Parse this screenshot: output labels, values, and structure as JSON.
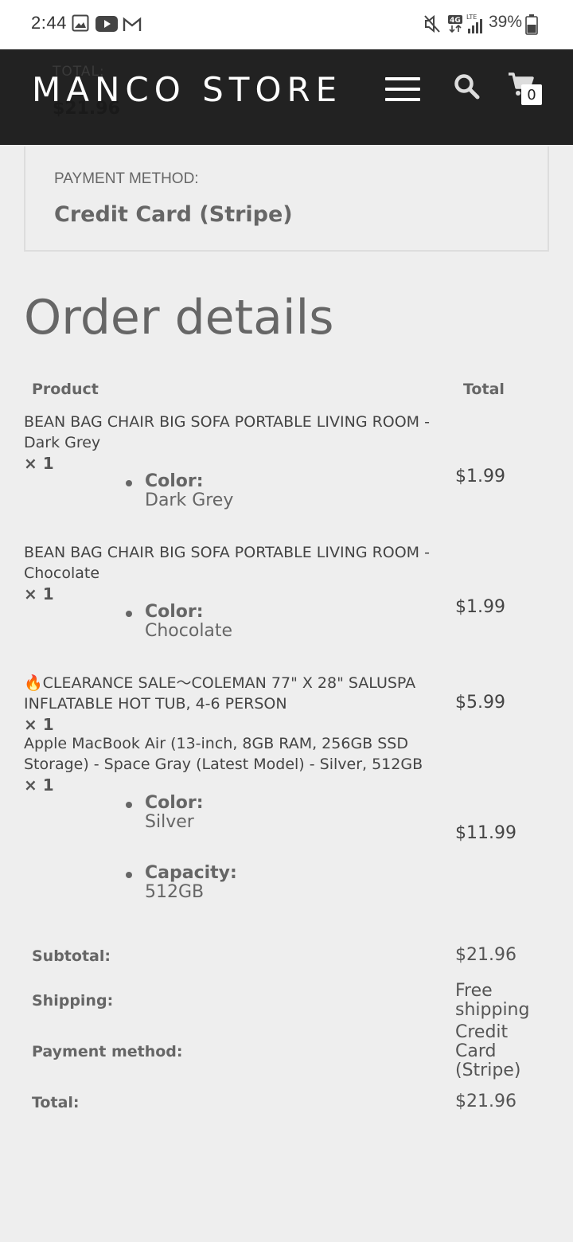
{
  "status_bar": {
    "time": "2:44",
    "battery": "39%",
    "network_badge": "4G",
    "lte": "LTE"
  },
  "header": {
    "brand": "MANCO STORE",
    "cart_count": "0",
    "ghost_total_label": "TOTAL:",
    "ghost_total_value": "$21.96"
  },
  "payment": {
    "label": "PAYMENT METHOD:",
    "value": "Credit Card (Stripe)"
  },
  "order": {
    "title": "Order details",
    "col_product": "Product",
    "col_total": "Total",
    "items": [
      {
        "name": "BEAN BAG CHAIR BIG SOFA PORTABLE LIVING ROOM - Dark Grey",
        "qty": "× 1",
        "meta": [
          {
            "key": "Color:",
            "value": "Dark Grey"
          }
        ],
        "price": "$1.99"
      },
      {
        "name": "BEAN BAG CHAIR BIG SOFA PORTABLE LIVING ROOM - Chocolate",
        "qty": "× 1",
        "meta": [
          {
            "key": "Color:",
            "value": "Chocolate"
          }
        ],
        "price": "$1.99"
      },
      {
        "name": "🔥CLEARANCE SALE～COLEMAN 77\" X 28\" SALUSPA INFLATABLE HOT TUB, 4-6 PERSON",
        "qty": "× 1",
        "meta": [],
        "price": "$5.99"
      },
      {
        "name": "Apple MacBook Air (13-inch, 8GB RAM, 256GB SSD Storage) - Space Gray (Latest Model) - Silver, 512GB",
        "qty": "× 1",
        "meta": [
          {
            "key": "Color:",
            "value": "Silver"
          },
          {
            "key": "Capacity:",
            "value": "512GB"
          }
        ],
        "price": "$11.99"
      }
    ],
    "subtotal_label": "Subtotal:",
    "subtotal_value": "$21.96",
    "shipping_label": "Shipping:",
    "shipping_value": "Free shipping",
    "method_label": "Payment method:",
    "method_value": "Credit Card (Stripe)",
    "total_label": "Total:",
    "total_value": "$21.96"
  },
  "icons": [
    "image-icon",
    "youtube-icon",
    "gmail-icon",
    "mute-icon",
    "signal-icon",
    "battery-icon",
    "menu-icon",
    "search-icon",
    "cart-icon"
  ]
}
